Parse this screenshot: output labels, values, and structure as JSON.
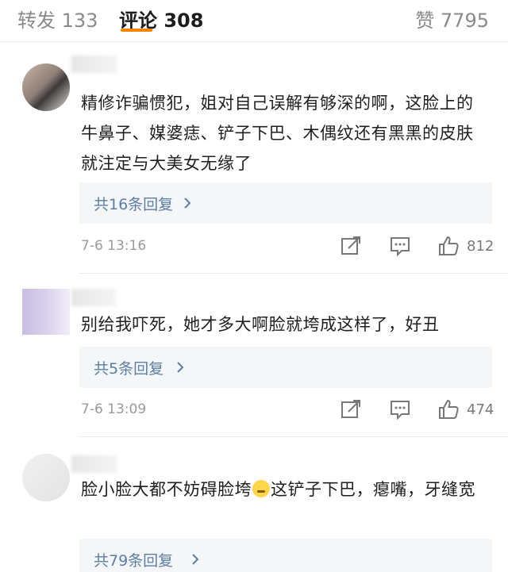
{
  "tabs": {
    "repost": "转发 133",
    "comments": "评论 308",
    "likes": "赞 7795"
  },
  "comments": [
    {
      "text": "精修诈骗惯犯，姐对自己误解有够深的啊，这脸上的牛鼻子、媒婆痣、铲子下巴、木偶纹还有黑黑的皮肤就注定与大美女无缘了",
      "replies": "共16条回复",
      "time": "7-6 13:16",
      "likes": "812"
    },
    {
      "text": "别给我吓死，她才多大啊脸就垮成这样了，好丑",
      "replies": "共5条回复",
      "time": "7-6 13:09",
      "likes": "474"
    },
    {
      "text_before_emoji": "脸小脸大都不妨碍脸垮",
      "text_after_emoji": "这铲子下巴，瘪嘴，牙缝宽",
      "emoji": "thinking-face-emoji",
      "replies": "共79条回复"
    }
  ],
  "colors": {
    "accent": "#ff8200",
    "reply_link": "#5b7ea6",
    "muted": "#9a9a9a"
  }
}
